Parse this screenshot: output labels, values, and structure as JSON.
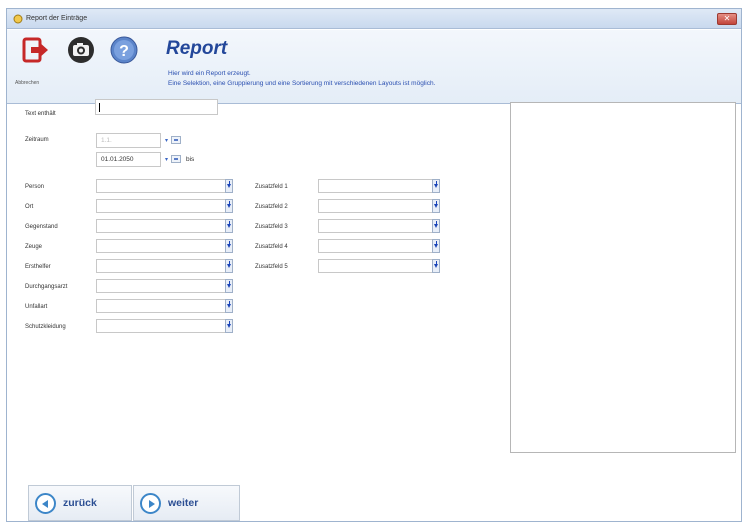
{
  "window": {
    "title": "Report der Einträge"
  },
  "toolbar": {
    "exit_label": "Abbrechen",
    "icons": [
      "exit-icon",
      "camera-icon",
      "help-icon"
    ]
  },
  "header": {
    "title": "Report",
    "line1": "Hier wird ein Report erzeugt.",
    "line2": "Eine Selektion, eine Gruppierung und eine Sortierung mit verschiedenen Layouts ist möglich."
  },
  "filters": {
    "text_label": "Text enthält",
    "text_value": "",
    "period_label": "Zeitraum",
    "from_value": "1.1.",
    "to_value": "01.01.2050",
    "to_separator": "bis"
  },
  "left_fields": [
    {
      "label": "Person"
    },
    {
      "label": "Ort"
    },
    {
      "label": "Gegenstand"
    },
    {
      "label": "Zeuge"
    },
    {
      "label": "Ersthelfer"
    },
    {
      "label": "Durchgangsarzt"
    },
    {
      "label": "Unfallart"
    },
    {
      "label": "Schutzkleidung"
    }
  ],
  "right_fields": [
    {
      "label": "Zusatzfeld 1"
    },
    {
      "label": "Zusatzfeld 2"
    },
    {
      "label": "Zusatzfeld 3"
    },
    {
      "label": "Zusatzfeld 4"
    },
    {
      "label": "Zusatzfeld 5"
    }
  ],
  "nav": {
    "back_label": "zurück",
    "next_label": "weiter"
  },
  "colors": {
    "accent": "#23479a",
    "nav_ring": "#3c86c8",
    "exit_red": "#c62828"
  }
}
